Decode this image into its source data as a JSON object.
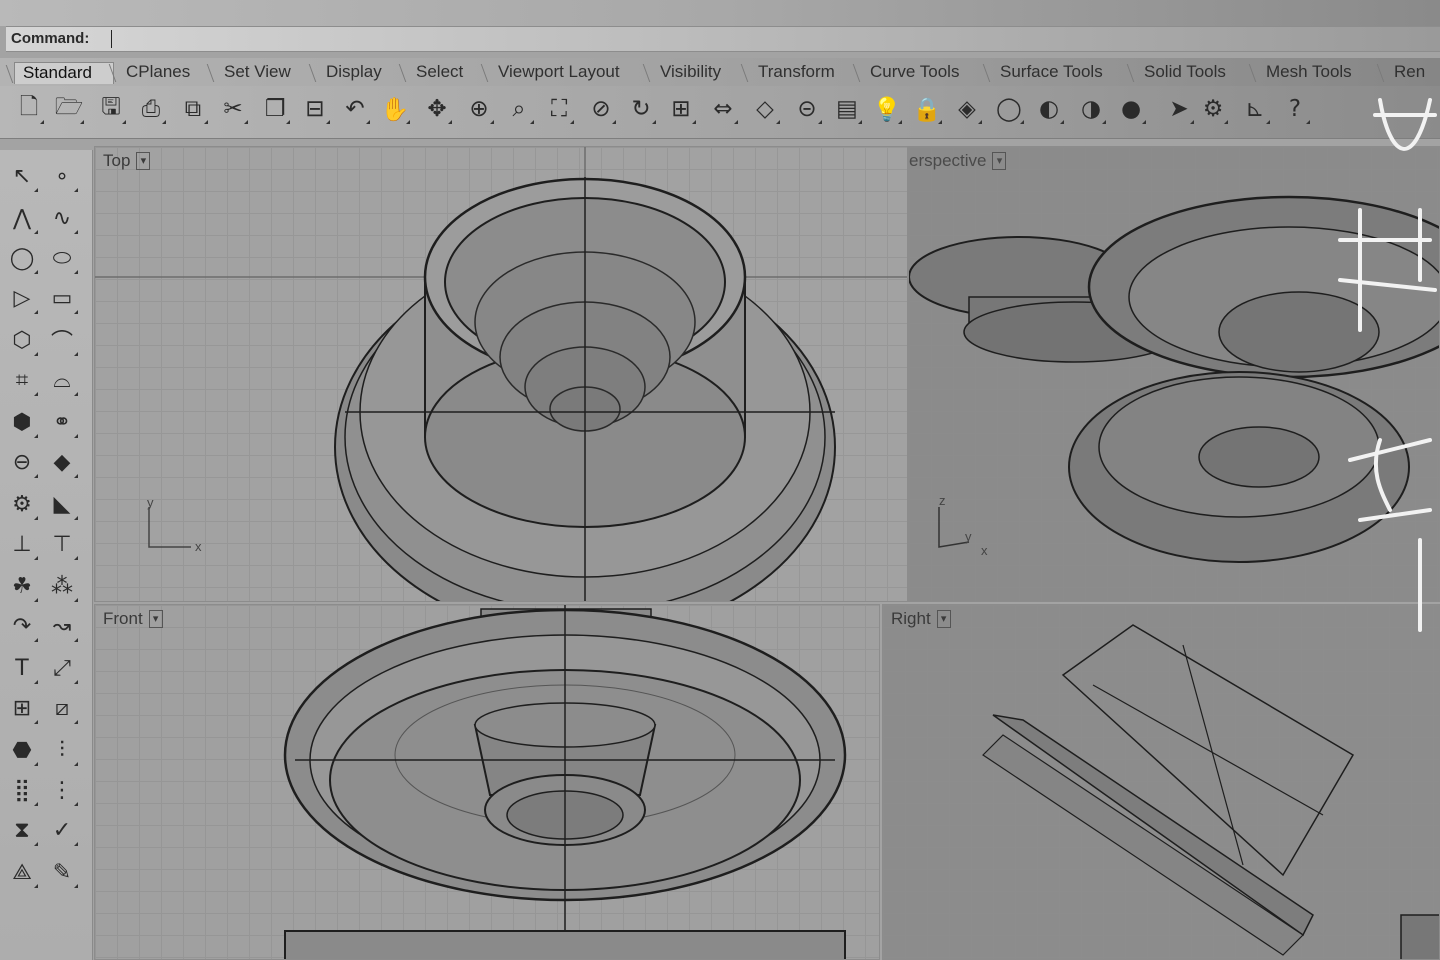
{
  "command": {
    "label": "Command:"
  },
  "tabs": [
    {
      "label": "Standard",
      "active": true
    },
    {
      "label": "CPlanes"
    },
    {
      "label": "Set View"
    },
    {
      "label": "Display"
    },
    {
      "label": "Select"
    },
    {
      "label": "Viewport Layout"
    },
    {
      "label": "Visibility"
    },
    {
      "label": "Transform"
    },
    {
      "label": "Curve Tools"
    },
    {
      "label": "Surface Tools"
    },
    {
      "label": "Solid Tools"
    },
    {
      "label": "Mesh Tools"
    },
    {
      "label": "Ren"
    }
  ],
  "toolbar_icons": [
    "new-file-icon",
    "open-folder-icon",
    "save-icon",
    "print-icon",
    "import-icon",
    "cut-icon",
    "copy-icon",
    "paste-icon",
    "undo-icon",
    "pan-hand-icon",
    "rotate-view-icon",
    "zoom-in-icon",
    "zoom-window-icon",
    "zoom-extents-icon",
    "zoom-selected-icon",
    "rotate-camera-icon",
    "four-viewports-icon",
    "named-view-icon",
    "cplane-icon",
    "measure-icon",
    "layer-icon",
    "light-icon",
    "lock-icon",
    "shaded-icon",
    "wireframe-sphere-icon",
    "shaded-sphere-icon",
    "rendered-sphere-icon",
    "material-sphere-icon",
    "select-arrow-icon",
    "settings-icon",
    "dimension-icon",
    "help-icon"
  ],
  "sidebar_icons": [
    "select-arrow-icon",
    "point-icon",
    "polyline-icon",
    "curve-control-icon",
    "circle-icon",
    "ellipse-icon",
    "triangle-icon",
    "rectangle-icon",
    "polygon-icon",
    "arc-curve-icon",
    "surface-corner-icon",
    "surface-loft-icon",
    "box-icon",
    "boolean-union-icon",
    "cylinder-icon",
    "mesh-plane-icon",
    "gear-icon",
    "dimension-icon",
    "extend-icon",
    "trim-icon",
    "boolean-icon",
    "points-icon",
    "fillet-icon",
    "blend-icon",
    "text-icon",
    "scale-icon",
    "group-icon",
    "array-icon",
    "solid-box-icon",
    "align-icon",
    "array-grid-icon",
    "distribute-icon",
    "transform-icon",
    "check-icon",
    "pyramid-icon",
    "edit-icon"
  ],
  "viewports": {
    "top": {
      "label": "Top"
    },
    "perspective": {
      "label": "erspective"
    },
    "front": {
      "label": "Front"
    },
    "right": {
      "label": "Right"
    }
  },
  "axes": {
    "top_y": "y",
    "top_x": "x",
    "persp_z": "z",
    "persp_y": "y",
    "persp_x": "x"
  }
}
